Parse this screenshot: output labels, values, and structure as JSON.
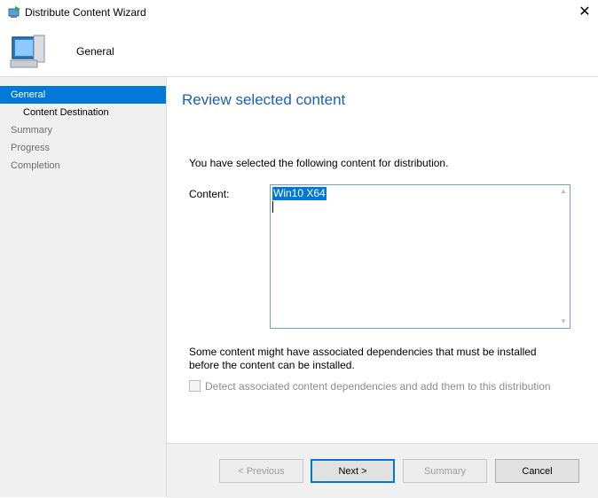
{
  "window": {
    "title": "Distribute Content Wizard",
    "close_glyph": "✕",
    "app_icon": "wizard-icon"
  },
  "header": {
    "page_name": "General",
    "icon": "computer-icon"
  },
  "sidebar": {
    "items": [
      {
        "label": "General"
      },
      {
        "label": "Content Destination"
      },
      {
        "label": "Summary"
      },
      {
        "label": "Progress"
      },
      {
        "label": "Completion"
      }
    ]
  },
  "main": {
    "heading": "Review selected content",
    "intro": "You have selected the following content for distribution.",
    "content_label": "Content:",
    "content_items": [
      "Win10 X64"
    ],
    "dependency_note": "Some content might have associated dependencies that must be installed before the content can be installed.",
    "dependency_checkbox": "Detect associated content dependencies and add them to this distribution"
  },
  "buttons": {
    "previous": "< Previous",
    "next": "Next >",
    "summary": "Summary",
    "cancel": "Cancel"
  },
  "colors": {
    "accent": "#0078d7",
    "heading": "#1e5eb1",
    "sidebar_bg": "#f0f0f0"
  }
}
